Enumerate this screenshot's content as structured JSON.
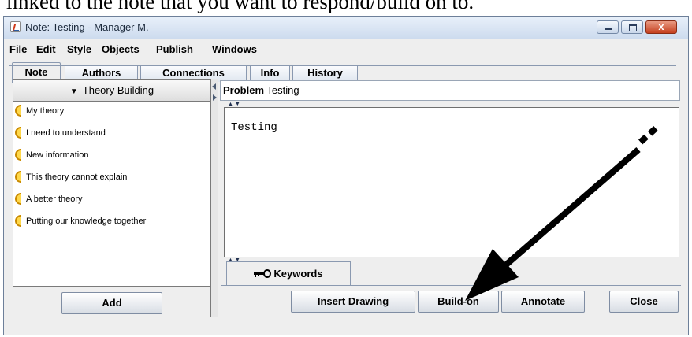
{
  "caption": "linked to the note that you want to respond/build on to.",
  "window": {
    "title": "Note: Testing - Manager M.",
    "controls": {
      "close_label": "x"
    }
  },
  "menu": [
    "File",
    "Edit",
    "Style",
    "Objects",
    "Publish",
    "Windows"
  ],
  "tabs": [
    {
      "label": "Note",
      "active": true
    },
    {
      "label": "Authors",
      "active": false
    },
    {
      "label": "Connections",
      "active": false
    },
    {
      "label": "Info",
      "active": false
    },
    {
      "label": "History",
      "active": false
    }
  ],
  "scaffold": {
    "header": "Theory Building",
    "items": [
      "My theory",
      "I need to understand",
      "New information",
      "This theory cannot explain",
      "A better theory",
      "Putting our knowledge together"
    ],
    "add_label": "Add"
  },
  "note": {
    "problem_label": "Problem",
    "problem_value": "Testing",
    "body_text": "Testing"
  },
  "keywords": {
    "label": "Keywords",
    "icon": "key-icon"
  },
  "buttons": {
    "insert_drawing": "Insert Drawing",
    "build_on": "Build-on",
    "annotate": "Annotate",
    "close": "Close"
  },
  "colors": {
    "scaffold_bracket": "#ffd84a",
    "titlebar": "#cddbee",
    "close_button": "#c5401f"
  }
}
